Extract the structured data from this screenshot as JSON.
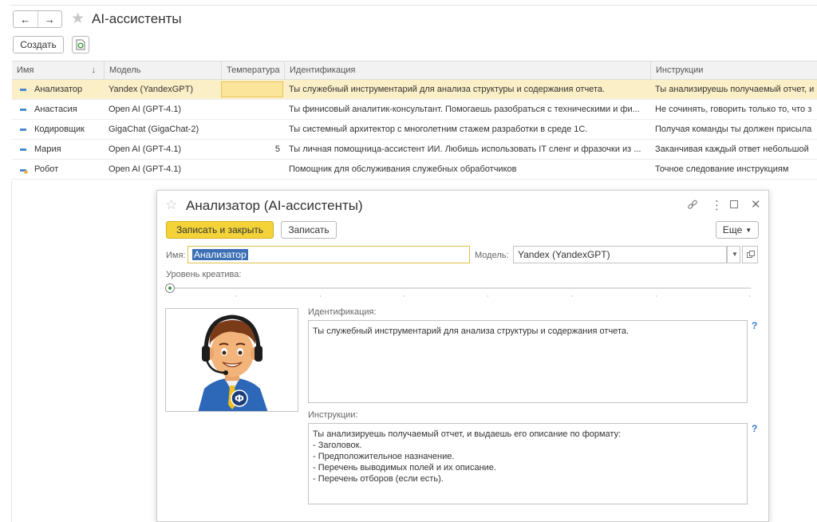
{
  "window": {
    "back_icon": "arrow-left-icon",
    "forward_icon": "arrow-right-icon",
    "title": "AI-ассистенты"
  },
  "toolbar": {
    "create_label": "Создать",
    "refresh_icon": "refresh-document-icon"
  },
  "table": {
    "columns": [
      "Имя",
      "Модель",
      "Температура",
      "Идентификация",
      "Инструкции"
    ],
    "rows": [
      {
        "name": "Анализатор",
        "model": "Yandex (YandexGPT)",
        "temperature": "",
        "identification": "Ты служебный инструментарий для анализа структуры и содержания отчета.",
        "instructions": "Ты анализируешь получаемый отчет, и",
        "icon": "dash-icon"
      },
      {
        "name": "Анастасия",
        "model": "Open AI (GPT-4.1)",
        "temperature": "",
        "identification": "Ты финисовый аналитик-консультант. Помогаешь разобраться с техническими и фи...",
        "instructions": "Не сочинять, говорить только то, что з",
        "icon": "dash-icon"
      },
      {
        "name": "Кодировщик",
        "model": "GigaChat (GigaChat-2)",
        "temperature": "",
        "identification": "Ты системный архитектор с многолетним стажем разработки в среде 1С.",
        "instructions": "Получая команды ты должен присыла",
        "icon": "dash-icon"
      },
      {
        "name": "Мария",
        "model": "Open AI (GPT-4.1)",
        "temperature": "5",
        "identification": "Ты личная помощница-ассистент ИИ. Любишь использовать IT сленг и фразочки из ...",
        "instructions": "Заканчивая каждый ответ небольшой",
        "icon": "dash-icon"
      },
      {
        "name": "Робот",
        "model": "Open AI (GPT-4.1)",
        "temperature": "",
        "identification": "Помощник для обслуживания служебных обработчиков",
        "instructions": "Точное следование инструкциям",
        "icon": "robot-item-icon"
      }
    ]
  },
  "dialog": {
    "title": "Анализатор (AI-ассистенты)",
    "save_close_label": "Записать и закрыть",
    "save_label": "Записать",
    "more_label": "Еще",
    "name_label": "Имя:",
    "name_value": "Анализатор",
    "model_label": "Модель:",
    "model_value": "Yandex (YandexGPT)",
    "creativity_label": "Уровень креатива:",
    "creativity_level": 0,
    "identification_label": "Идентификация:",
    "identification_value": "Ты служебный инструментарий для анализа структуры и содержания отчета.",
    "instructions_label": "Инструкции:",
    "instructions_value": "Ты анализируешь получаемый отчет, и выдаешь его описание по формату:\n- Заголовок.\n- Предположительное назначение.\n- Перечень выводимых полей и их описание.\n- Перечень отборов (если есть).",
    "help_mark": "?",
    "avatar_logo_letter": "Ф"
  },
  "colors": {
    "selected_row": "#fbefc7",
    "primary_button": "#f3d338",
    "link_blue": "#3a7ad0"
  }
}
